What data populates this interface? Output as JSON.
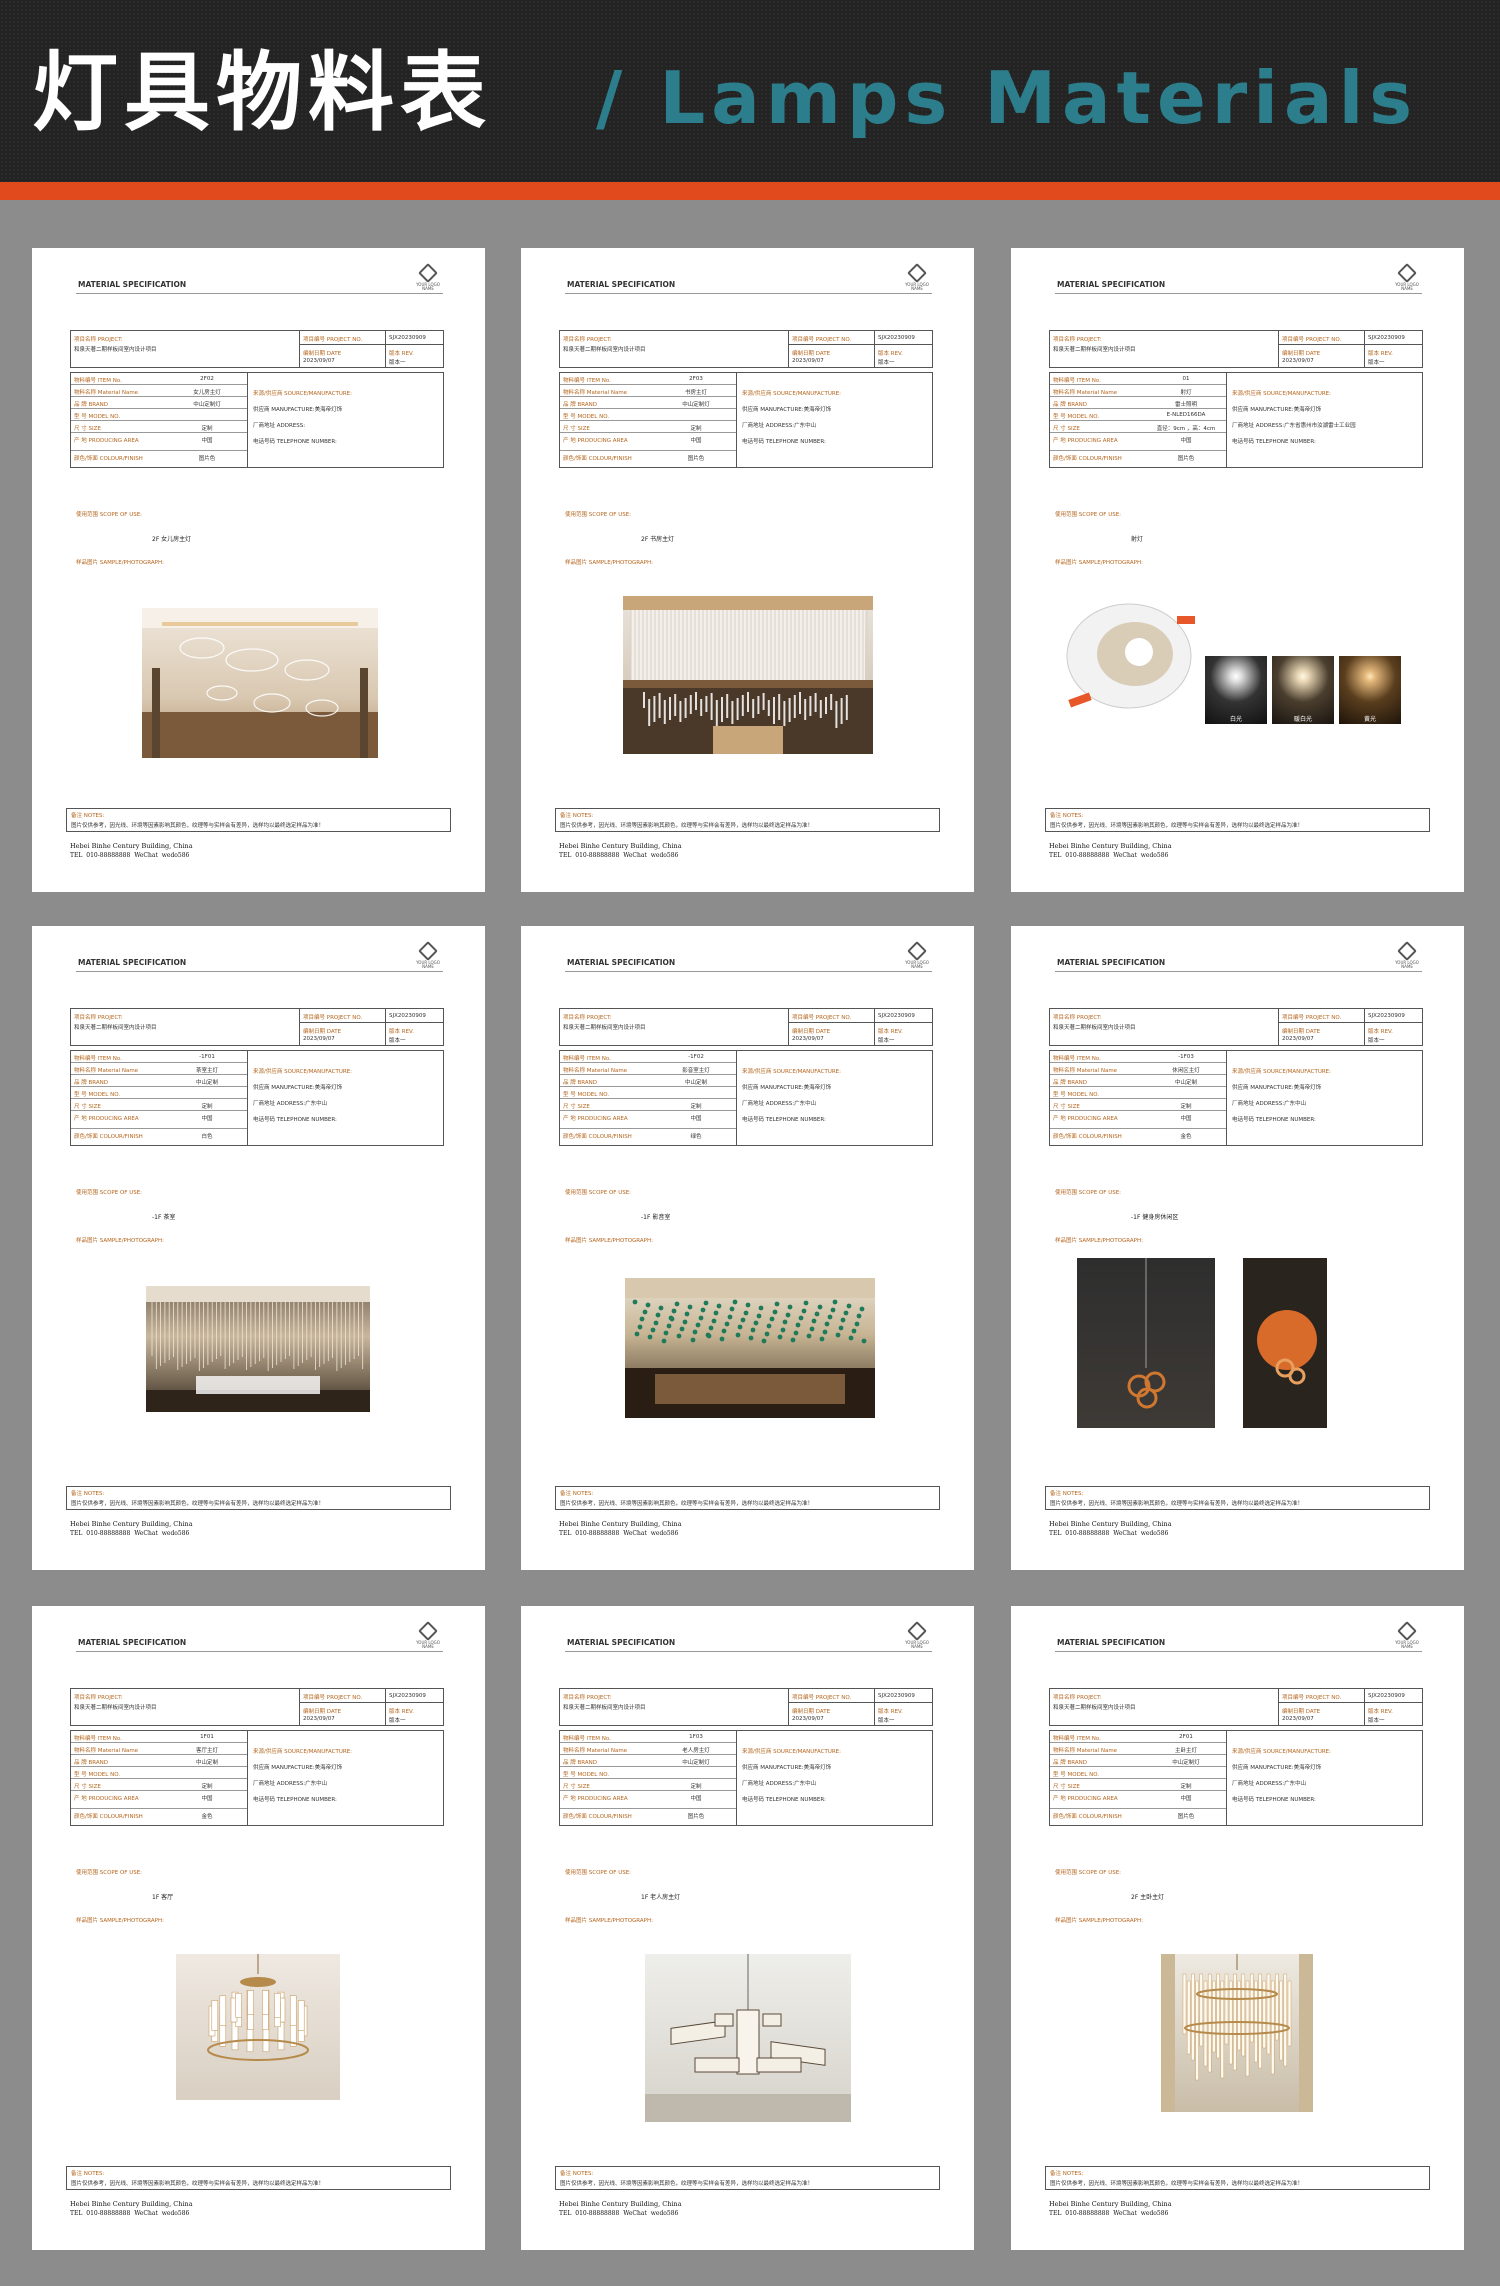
{
  "header": {
    "title_zh": "灯具物料表",
    "title_en": "/ Lamps Materials"
  },
  "common": {
    "spec_title": "MATERIAL SPECIFICATION",
    "logo_text": "YOUR LOGO NAME",
    "project_label": "项目名称  PROJECT:",
    "project_value": "和泉天著二期样板间室内设计项目",
    "project_no_label": "项目编号  PROJECT NO.",
    "project_no_value": "SJX20230909",
    "date_label": "编制日期  DATE",
    "date_value": "2023/09/07",
    "rev_label": "版本  REV.",
    "rev_value": "版本一",
    "k_item": "物料编号  ITEM No.",
    "k_name": "物料名称  Material Name",
    "k_brand": "品    牌  BRAND",
    "k_model": "型    号  MODEL NO.",
    "k_size": "尺    寸  SIZE",
    "k_area": "产    地  PRODUCING AREA",
    "k_colour": "颜色/饰面 COLOUR/FINISH",
    "src_label": "来源/供应商  SOURCE/MANUFACTURE:",
    "mfr_label": "供应商   MANUFACTURE:",
    "addr_label": "厂商地址   ADDRESS:",
    "tel_label": "电话号码  TELEPHONE NUMBER:",
    "scope_label": "使用范围   SCOPE OF USE:",
    "sample_label": "样品图片   SAMPLE/PHOTOGRAPH:",
    "notes_label": "备注   NOTES:",
    "notes_text": "图片仅供参考，因光线、环境等因素影响其颜色，纹理等与实样会有差异，选样均以最终选定样品为准！",
    "foot_address": "Hebei Binhe Century Building, China",
    "foot_contact": "TEL   010-88888888      WeChat   wedo586"
  },
  "sheets": [
    {
      "item": "2F02",
      "name": "女儿房主灯",
      "brand": "中山定制灯",
      "model": "",
      "size": "定制",
      "area": "中国",
      "colour": "图片色",
      "manufacture": "美海帝灯饰",
      "address": "",
      "scope": "2F 女儿房主灯"
    },
    {
      "item": "2F03",
      "name": "书房主灯",
      "brand": "中山定制灯",
      "model": "",
      "size": "定制",
      "area": "中国",
      "colour": "图片色",
      "manufacture": "美海帝灯饰",
      "address": "广东中山",
      "scope": "2F 书房主灯"
    },
    {
      "item": "01",
      "name": "射灯",
      "brand": "雷士照明",
      "model": "E-NLED166DA",
      "size": "直径：9cm ，高：4cm",
      "area": "中国",
      "colour": "图片色",
      "manufacture": "美海帝灯饰",
      "address": "广东省惠州市汝湖雷士工业园",
      "scope": "射灯",
      "temps": [
        "白光",
        "暖白光",
        "黄光"
      ]
    },
    {
      "item": "-1F01",
      "name": "茶室主灯",
      "brand": "中山定制",
      "model": "",
      "size": "定制",
      "area": "中国",
      "colour": "白色",
      "manufacture": "美海帝灯饰",
      "address": "广东中山",
      "scope": "-1F 茶室"
    },
    {
      "item": "-1F02",
      "name": "影音室主灯",
      "brand": "中山定制",
      "model": "",
      "size": "定制",
      "area": "中国",
      "colour": "绿色",
      "manufacture": "美海帝灯饰",
      "address": "广东中山",
      "scope": "-1F 影音室"
    },
    {
      "item": "-1F03",
      "name": "休闲区主灯",
      "brand": "中山定制",
      "model": "",
      "size": "定制",
      "area": "中国",
      "colour": "金色",
      "manufacture": "美海帝灯饰",
      "address": "广东中山",
      "scope": "-1F 健身房休闲区"
    },
    {
      "item": "1F01",
      "name": "客厅主灯",
      "brand": "中山定制",
      "model": "",
      "size": "定制",
      "area": "中国",
      "colour": "金色",
      "manufacture": "美海帝灯饰",
      "address": "广东中山",
      "scope": "1F 客厅"
    },
    {
      "item": "1F03",
      "name": "老人房主灯",
      "brand": "中山定制灯",
      "model": "",
      "size": "定制",
      "area": "中国",
      "colour": "图片色",
      "manufacture": "美海帝灯饰",
      "address": "广东中山",
      "scope": "1F 老人房主灯"
    },
    {
      "item": "2F01",
      "name": "主卧主灯",
      "brand": "中山定制灯",
      "model": "",
      "size": "定制",
      "area": "中国",
      "colour": "图片色",
      "manufacture": "美海帝灯饰",
      "address": "广东中山",
      "scope": "2F 主卧主灯"
    }
  ]
}
